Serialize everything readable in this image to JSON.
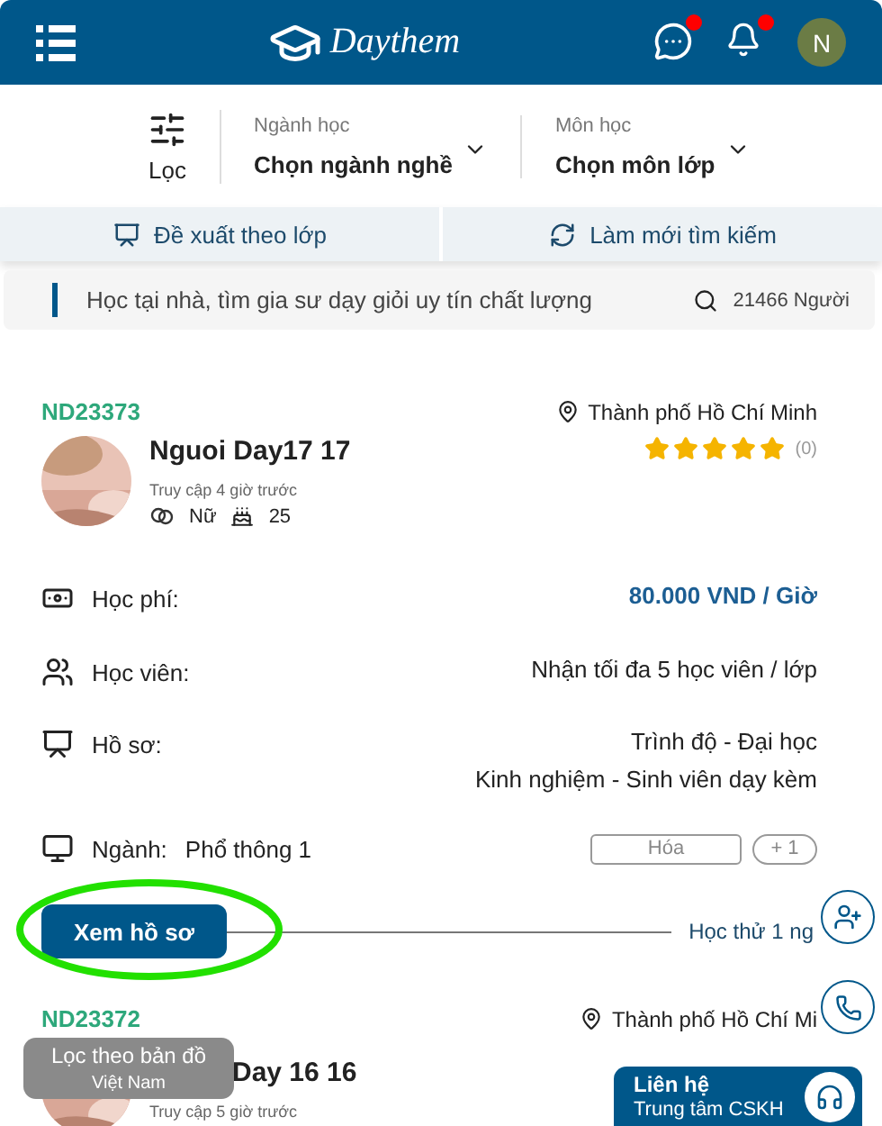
{
  "header": {
    "logo": "Daythem",
    "avatar_initial": "N",
    "chat_unread": true,
    "bell_unread": true
  },
  "filters": {
    "filter_label": "Lọc",
    "dropdowns": [
      {
        "label": "Ngành học",
        "value": "Chọn ngành nghề"
      },
      {
        "label": "Môn học",
        "value": "Chọn môn lớp"
      }
    ]
  },
  "actions": [
    {
      "kind": "suggest",
      "label": "Đề xuất theo lớp"
    },
    {
      "kind": "refresh",
      "label": "Làm mới tìm kiếm"
    }
  ],
  "search": {
    "placeholder": "Học tại nhà, tìm gia sư dạy giỏi uy tín chất lượng",
    "count": "21466 Người"
  },
  "tutors": [
    {
      "code": "ND23373",
      "city": "Thành phố Hồ Chí Minh",
      "name": "Nguoi Day17 17",
      "last_seen": "Truy cập 4 giờ trước",
      "gender": "Nữ",
      "age": "25",
      "stars": 5,
      "review_count": "(0)",
      "fee_label": "Học phí:",
      "fee": "80.000 VND / Giờ",
      "students_label": "Học viên:",
      "students": "Nhận tối đa 5 học viên / lớp",
      "profile_label": "Hồ sơ:",
      "profile_lines": [
        "Trình độ - Đại học",
        "Kinh nghiệm - Sinh viên dạy kèm"
      ],
      "field_label": "Ngành:",
      "field": "Phổ thông 1",
      "subjects": [
        "Hóa",
        "+ 1"
      ],
      "view_button": "Xem hồ sơ",
      "trial": "Học thử 1 ng"
    },
    {
      "code": "ND23372",
      "city": "Thành phố Hồ Chí Mi",
      "name": "Day 16 16",
      "last_seen": "Truy cập 5 giờ trước"
    }
  ],
  "map_button": {
    "title": "Lọc theo bản đồ",
    "subtitle": "Việt Nam"
  },
  "contact_button": {
    "title": "Liên hệ",
    "subtitle": "Trung tâm CSKH"
  }
}
